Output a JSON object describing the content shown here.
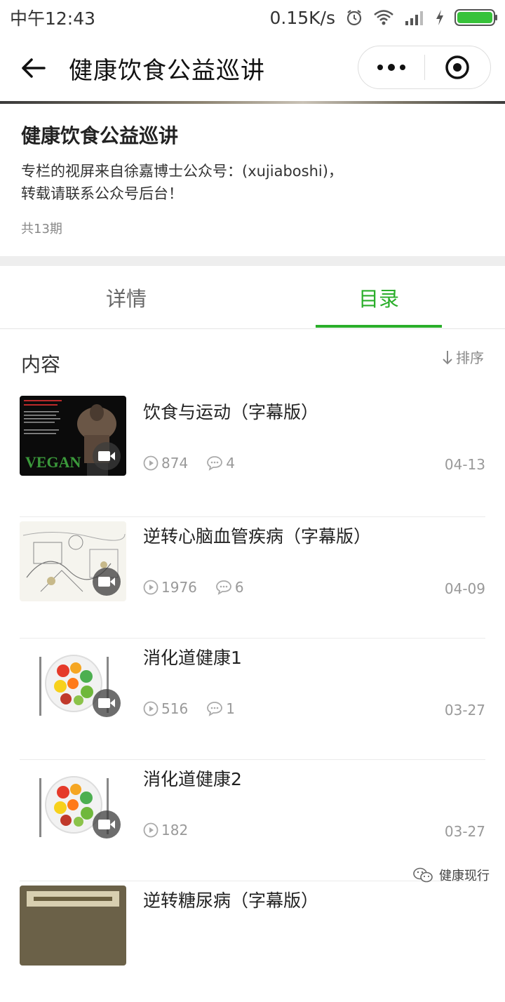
{
  "status_bar": {
    "carrier_time": "中午12:43",
    "net_speed": "0.15K/s",
    "icons": [
      "alarm-icon",
      "wifi-icon",
      "signal-icon",
      "charging-icon",
      "battery-icon"
    ]
  },
  "nav": {
    "title": "健康饮食公益巡讲",
    "back_icon": "back-arrow-icon",
    "more_icon": "more-dots-icon",
    "close_icon": "target-circle-icon"
  },
  "column": {
    "title": "健康饮食公益巡讲",
    "desc_line1": "专栏的视屏来自徐嘉博士公众号：(xujiaboshi)，",
    "desc_line2": "转载请联系公众号后台！",
    "count": "共13期"
  },
  "tabs": {
    "details": "详情",
    "catalog": "目录",
    "active": "catalog",
    "accent": "#2aae2a"
  },
  "section": {
    "title": "内容",
    "sort_label": "排序"
  },
  "items": [
    {
      "title": "饮食与运动（字幕版）",
      "plays": "874",
      "comments": "4",
      "date": "04-13",
      "thumb_text": "VEGAN"
    },
    {
      "title": "逆转心脑血管疾病（字幕版）",
      "plays": "1976",
      "comments": "6",
      "date": "04-09"
    },
    {
      "title": "消化道健康1",
      "plays": "516",
      "comments": "1",
      "date": "03-27"
    },
    {
      "title": "消化道健康2",
      "plays": "182",
      "comments": "",
      "date": "03-27"
    },
    {
      "title": "逆转糖尿病（字幕版）",
      "plays": "",
      "comments": "",
      "date": ""
    }
  ],
  "watermark": "健康现行"
}
